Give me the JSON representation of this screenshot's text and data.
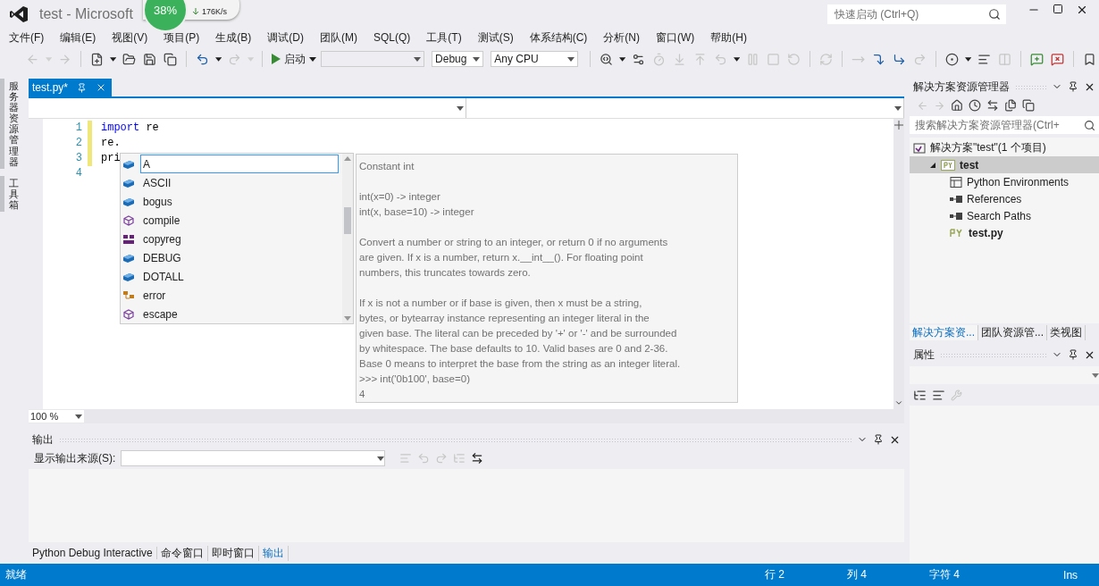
{
  "window": {
    "title": "test - Microsoft",
    "quick_launch": {
      "placeholder": "快速启动 (Ctrl+Q)"
    }
  },
  "net_monitor": {
    "percent": "38%",
    "download": "176K/s"
  },
  "menu": [
    "文件(F)",
    "编辑(E)",
    "视图(V)",
    "项目(P)",
    "生成(B)",
    "调试(D)",
    "团队(M)",
    "SQL(Q)",
    "工具(T)",
    "测试(S)",
    "体系结构(C)",
    "分析(N)",
    "窗口(W)",
    "帮助(H)"
  ],
  "toolbar": [
    {
      "kind": "back",
      "disabled": true
    },
    {
      "kind": "caret",
      "disabled": true
    },
    {
      "kind": "forward",
      "disabled": true
    },
    {
      "kind": "separator"
    },
    {
      "kind": "new",
      "disabled": false
    },
    {
      "kind": "caret",
      "disabled": false
    },
    {
      "kind": "open",
      "disabled": false
    },
    {
      "kind": "save",
      "disabled": false
    },
    {
      "kind": "saveall",
      "disabled": false
    },
    {
      "kind": "separator"
    },
    {
      "kind": "undo",
      "disabled": false
    },
    {
      "kind": "caret",
      "disabled": false
    },
    {
      "kind": "redo",
      "disabled": true
    },
    {
      "kind": "caret",
      "disabled": true
    },
    {
      "kind": "separator"
    },
    {
      "kind": "start",
      "label": "启动",
      "disabled": false
    },
    {
      "kind": "combo"
    },
    {
      "kind": "combo",
      "value": "Debug"
    },
    {
      "kind": "combo",
      "value": "Any CPU"
    },
    {
      "kind": "separator"
    },
    {
      "kind": "find",
      "disabled": false
    },
    {
      "kind": "caret",
      "disabled": false
    },
    {
      "kind": "attach",
      "disabled": false
    },
    {
      "kind": "timer",
      "disabled": true
    },
    {
      "kind": "down",
      "disabled": true
    },
    {
      "kind": "up",
      "disabled": true
    },
    {
      "kind": "undo",
      "disabled": true
    },
    {
      "kind": "caret",
      "disabled": false
    },
    {
      "kind": "pause",
      "disabled": true
    },
    {
      "kind": "stop",
      "disabled": true
    },
    {
      "kind": "restart",
      "disabled": true
    },
    {
      "kind": "separator"
    },
    {
      "kind": "refresh",
      "disabled": true
    },
    {
      "kind": "separator"
    },
    {
      "kind": "arrow",
      "disabled": true
    },
    {
      "kind": "stepinto",
      "disabled": false
    },
    {
      "kind": "stepover",
      "disabled": false
    },
    {
      "kind": "redo",
      "disabled": true
    },
    {
      "kind": "separator"
    },
    {
      "kind": "breakpoints",
      "disabled": false
    },
    {
      "kind": "caret",
      "disabled": false
    },
    {
      "kind": "format",
      "disabled": false
    },
    {
      "kind": "columns",
      "disabled": true
    },
    {
      "kind": "separator"
    },
    {
      "kind": "comment",
      "disabled": false
    },
    {
      "kind": "uncomment",
      "disabled": false
    },
    {
      "kind": "separator"
    },
    {
      "kind": "bookmark",
      "disabled": false
    }
  ],
  "side_tabs": [
    "服务器资源管理器",
    "工具箱"
  ],
  "editor": {
    "tab": {
      "label": "test.py*",
      "selected": true
    },
    "lines": [
      {
        "number": "1",
        "tokens": [
          {
            "kind": "keyword",
            "text": "import"
          },
          {
            "kind": "plain",
            "text": " re"
          }
        ],
        "changed": true
      },
      {
        "number": "2",
        "tokens": [
          {
            "kind": "plain",
            "text": "re."
          }
        ],
        "changed": true
      },
      {
        "number": "3",
        "tokens": [
          {
            "kind": "plain",
            "text": "pri"
          }
        ],
        "changed": true
      },
      {
        "number": "4",
        "changed": false
      }
    ],
    "zoom": "100 %",
    "completion": [
      {
        "label": "A",
        "kind": "constant",
        "selected": true
      },
      {
        "label": "ASCII",
        "kind": "constant",
        "selected": false
      },
      {
        "label": "bogus",
        "kind": "constant",
        "selected": false
      },
      {
        "label": "compile",
        "kind": "function",
        "selected": false
      },
      {
        "label": "copyreg",
        "kind": "module",
        "selected": false
      },
      {
        "label": "DEBUG",
        "kind": "constant",
        "selected": false
      },
      {
        "label": "DOTALL",
        "kind": "constant",
        "selected": false
      },
      {
        "label": "error",
        "kind": "class",
        "selected": false
      },
      {
        "label": "escape",
        "kind": "function",
        "selected": false
      }
    ],
    "tooltip": [
      [
        "Constant int"
      ],
      [
        "int(x=0) -> integer",
        "int(x, base=10) -> integer"
      ],
      [
        "Convert a number or string to an integer, or return 0 if no arguments",
        "are given.  If x is a number, return x.__int__().  For floating point",
        "numbers, this truncates towards zero."
      ],
      [
        "If x is not a number or if base is given, then x must be a string,",
        "bytes, or bytearray instance representing an integer literal in the",
        "given base.  The literal can be preceded by '+' or '-' and be surrounded",
        "by whitespace.  The base defaults to 10.  Valid bases are 0 and 2-36.",
        "Base 0 means to interpret the base from the string as an integer literal.",
        ">>> int('0b100', base=0)",
        "4"
      ]
    ]
  },
  "output": {
    "title": "输出",
    "source_label": "显示输出来源(S):",
    "tabs": [
      {
        "label": "Python Debug Interactive",
        "selected": false
      },
      {
        "label": "命令窗口",
        "selected": false
      },
      {
        "label": "即时窗口",
        "selected": false
      },
      {
        "label": "输出",
        "selected": true
      }
    ]
  },
  "solution_explorer": {
    "title": "解决方案资源管理器",
    "search": {
      "placeholder": "搜索解决方案资源管理器(Ctrl+"
    },
    "tree": [
      {
        "label": "解决方案\"test\"(1 个项目)",
        "kind": "solution",
        "selected": false,
        "expanded": true,
        "children": [
          {
            "label": "test",
            "kind": "project",
            "selected": true,
            "expanded": true,
            "children": [
              {
                "label": "Python Environments",
                "kind": "environments",
                "selected": false
              },
              {
                "label": "References",
                "kind": "references",
                "selected": false
              },
              {
                "label": "Search Paths",
                "kind": "references",
                "selected": false
              },
              {
                "label": "test.py",
                "kind": "file",
                "selected": false
              }
            ]
          }
        ]
      }
    ],
    "tabs": [
      {
        "label": "解决方案资...",
        "selected": true
      },
      {
        "label": "团队资源管...",
        "selected": false
      },
      {
        "label": "类视图",
        "selected": false
      }
    ]
  },
  "properties": {
    "title": "属性"
  },
  "status_bar": {
    "message": "就绪",
    "line": "行 2",
    "column": "列 4",
    "char": "字符 4",
    "mode": "Ins"
  }
}
